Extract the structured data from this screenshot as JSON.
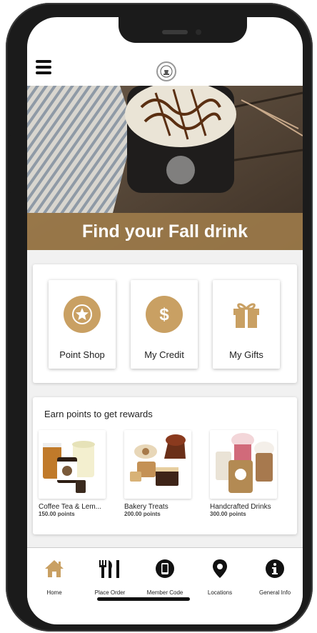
{
  "colors": {
    "accent": "#c9a063",
    "hero_caption_bg": "#a07d4b",
    "nav_home_active": "#c9a063"
  },
  "header": {
    "menu_icon": "hamburger-menu-icon",
    "logo_icon": "brand-logo-icon"
  },
  "hero": {
    "caption": "Find your Fall drink"
  },
  "quick_actions": [
    {
      "label": "Point Shop",
      "icon": "star-icon"
    },
    {
      "label": "My Credit",
      "icon": "dollar-icon"
    },
    {
      "label": "My Gifts",
      "icon": "gift-icon"
    }
  ],
  "rewards": {
    "title": "Earn points to get rewards",
    "items": [
      {
        "name": "Coffee Tea & Lem...",
        "points": "150.00 points"
      },
      {
        "name": "Bakery Treats",
        "points": "200.00 points"
      },
      {
        "name": "Handcrafted Drinks",
        "points": "300.00 points"
      }
    ]
  },
  "bottom_nav": [
    {
      "label": "Home",
      "icon": "home-icon"
    },
    {
      "label": "Place Order",
      "icon": "cutlery-icon"
    },
    {
      "label": "Member Code",
      "icon": "phone-icon"
    },
    {
      "label": "Locations",
      "icon": "location-pin-icon"
    },
    {
      "label": "General Info",
      "icon": "info-icon"
    }
  ]
}
